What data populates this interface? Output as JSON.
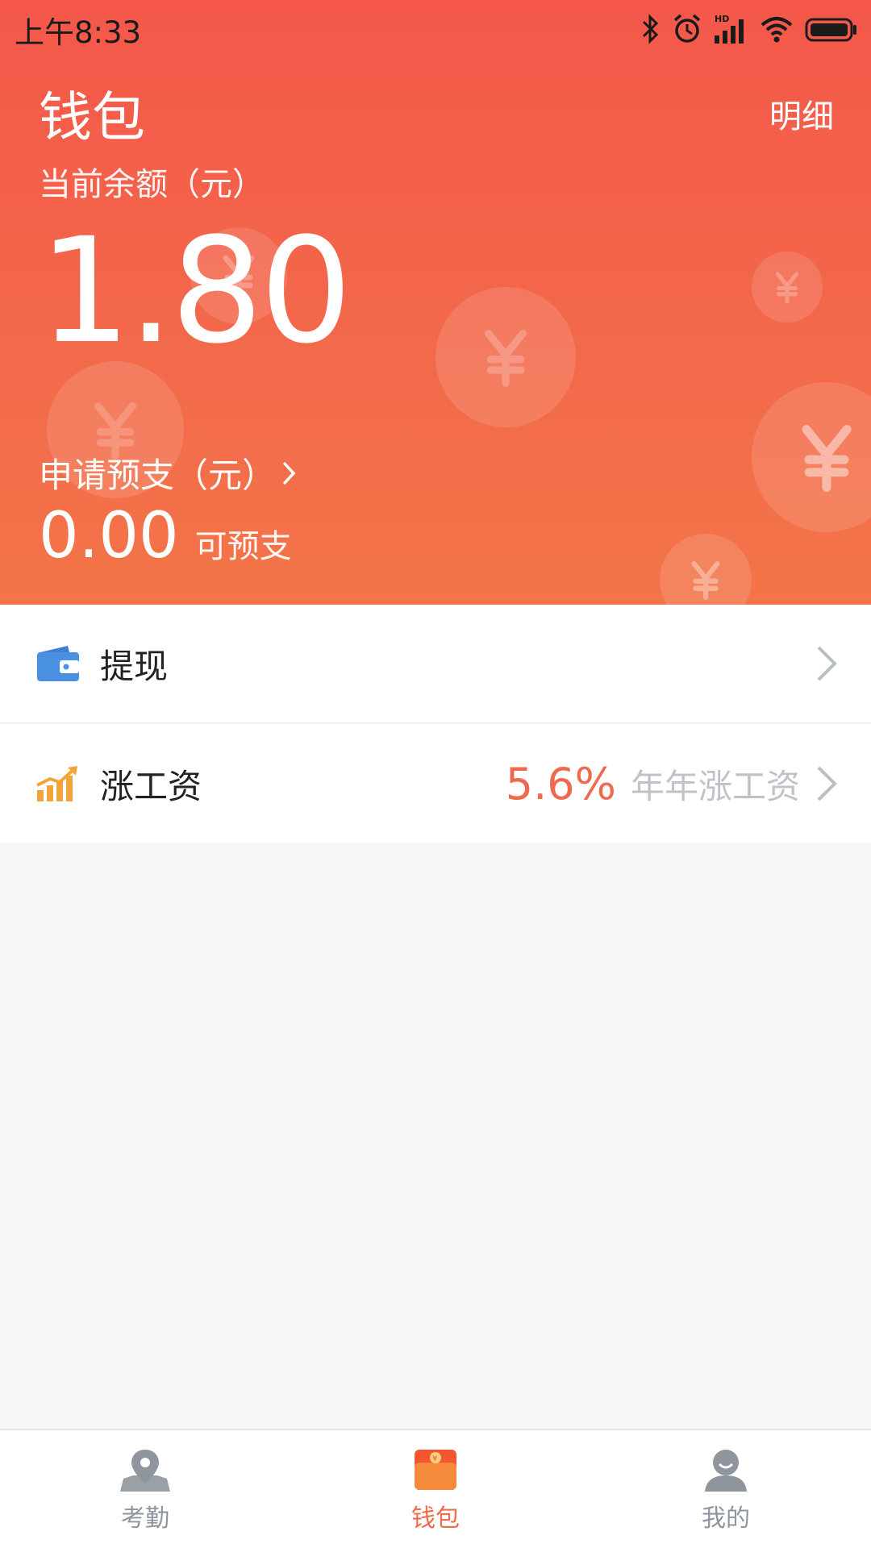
{
  "status": {
    "time": "上午8:33"
  },
  "header": {
    "title": "钱包",
    "detail_link": "明细",
    "balance_label": "当前余额（元）",
    "balance": "1.80",
    "advance_link": "申请预支（元）",
    "advance_amount": "0.00",
    "advance_note": "可预支"
  },
  "list": {
    "withdraw": {
      "label": "提现",
      "icon": "wallet-icon"
    },
    "raise": {
      "label": "涨工资",
      "rate": "5.6%",
      "note": "年年涨工资",
      "icon": "growth-chart-icon"
    }
  },
  "nav": {
    "items": [
      {
        "label": "考勤",
        "icon": "location-pin-icon",
        "active": false
      },
      {
        "label": "钱包",
        "icon": "wallet-bag-icon",
        "active": true
      },
      {
        "label": "我的",
        "icon": "user-icon",
        "active": false
      }
    ]
  },
  "colors": {
    "header_top": "#f4574a",
    "header_bottom": "#f37548",
    "accent": "#f36a4b",
    "rate": "#ee6a4f",
    "nav_inactive": "#8f959c"
  }
}
